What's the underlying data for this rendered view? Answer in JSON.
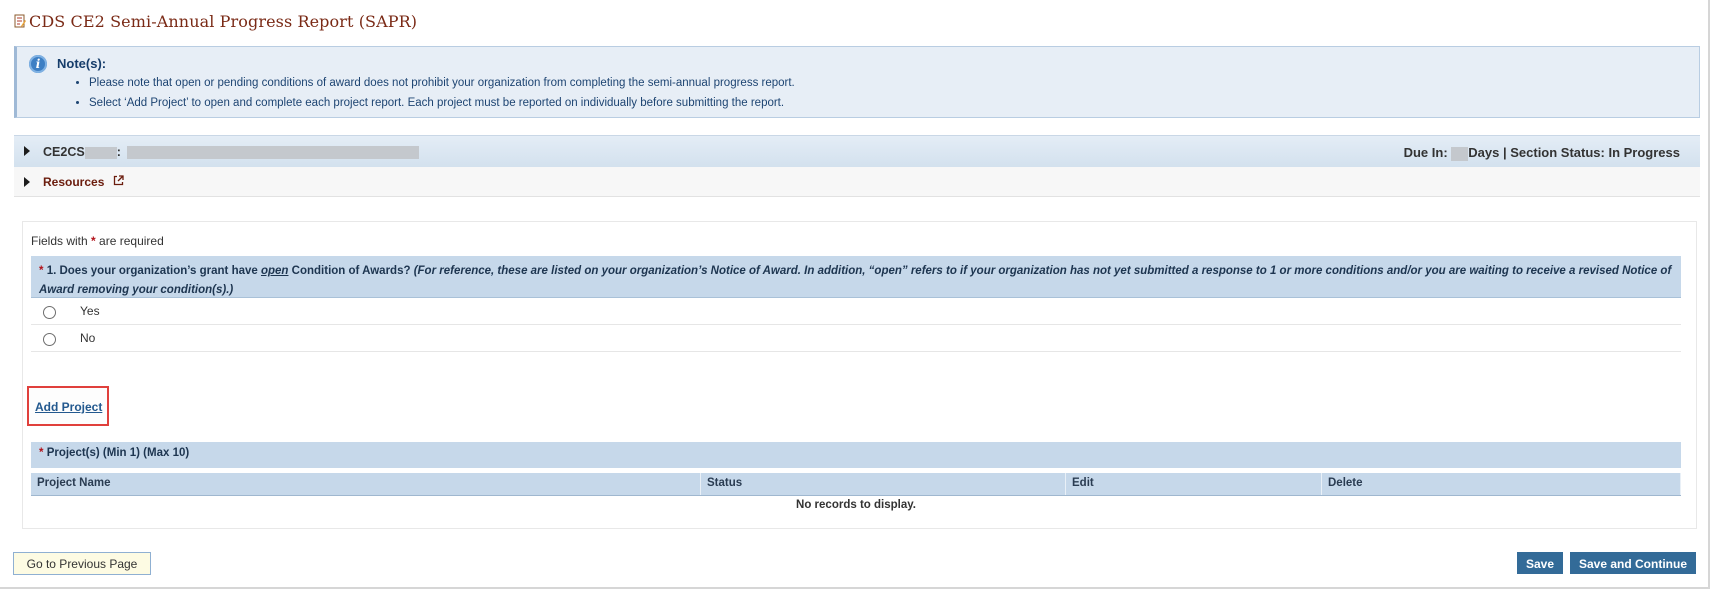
{
  "page": {
    "title": "CDS CE2 Semi-Annual Progress Report (SAPR)"
  },
  "notes": {
    "title": "Note(s):",
    "items": [
      "Please note that open or pending conditions of award does not prohibit your organization from completing the semi-annual progress report.",
      "Select ‘Add Project’ to open and complete each project report. Each project must be reported on individually before submitting the report."
    ]
  },
  "award_header": {
    "code_prefix": "CE2CS",
    "separator": ":",
    "due_label": "Due In:",
    "days_label": "Days",
    "section_status": "| Section Status: In Progress"
  },
  "resources": {
    "label": "Resources",
    "icon": "external-link-icon"
  },
  "form": {
    "required_note_prefix": "Fields with",
    "required_note_suffix": "are required",
    "question": {
      "number": "1. Does your organization’s grant have",
      "emphasis": "open",
      "text": "Condition of Awards?",
      "hint": "(For reference, these are listed on your organization’s Notice of Award. In addition, “open” refers to if your organization has not yet submitted a response to 1 or more conditions and/or you are waiting to receive a revised Notice of Award removing your condition(s).)"
    },
    "options": [
      "Yes",
      "No"
    ],
    "add_project_label": "Add Project",
    "projects_header": "Project(s) (Min 1) (Max 10)",
    "columns": [
      "Project Name",
      "Status",
      "Edit",
      "Delete"
    ],
    "empty_message": "No records to display."
  },
  "footer": {
    "previous_label": "Go to Previous Page",
    "save_label": "Save",
    "save_continue_label": "Save and Continue"
  },
  "colors": {
    "title": "#7a2a16",
    "header_blue": "#c6d8ea",
    "button_blue": "#336b98",
    "highlight_red": "#e0403c"
  }
}
